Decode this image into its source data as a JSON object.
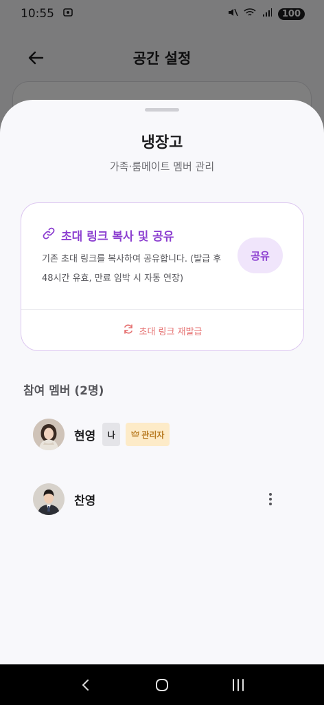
{
  "status_bar": {
    "time": "10:55",
    "battery": "100",
    "icons": [
      "screenshot-icon",
      "mute-icon",
      "wifi-icon",
      "signal-icon"
    ]
  },
  "background_page": {
    "title": "공간 설정",
    "back_icon": "arrow-left-icon"
  },
  "sheet": {
    "title": "냉장고",
    "subtitle": "가족·룸메이트 멤버 관리",
    "invite": {
      "heading": "초대 링크 복사 및 공유",
      "heading_icon": "link-icon",
      "description": "기존 초대 링크를 복사하여 공유합니다. (발급 후 48시간 유효, 만료 임박 시 자동 연장)",
      "share_button": "공유",
      "reissue_label": "초대 링크 재발급",
      "reissue_icon": "refresh-icon"
    },
    "members_title": "참여 멤버 (2명)",
    "members": [
      {
        "name": "현영",
        "me_badge": "나",
        "admin_badge": "관리자",
        "admin_icon": "crown-icon"
      },
      {
        "name": "찬영",
        "more_icon": "more-vertical-icon"
      }
    ]
  },
  "nav_bar": {
    "items": [
      "back-nav-icon",
      "home-nav-icon",
      "recents-nav-icon"
    ]
  },
  "colors": {
    "accent": "#8c3fd0",
    "accent_soft": "#f0e5fb",
    "reissue": "#e56f6f",
    "admin_bg": "#fdebc8",
    "admin_text": "#b7791f"
  }
}
